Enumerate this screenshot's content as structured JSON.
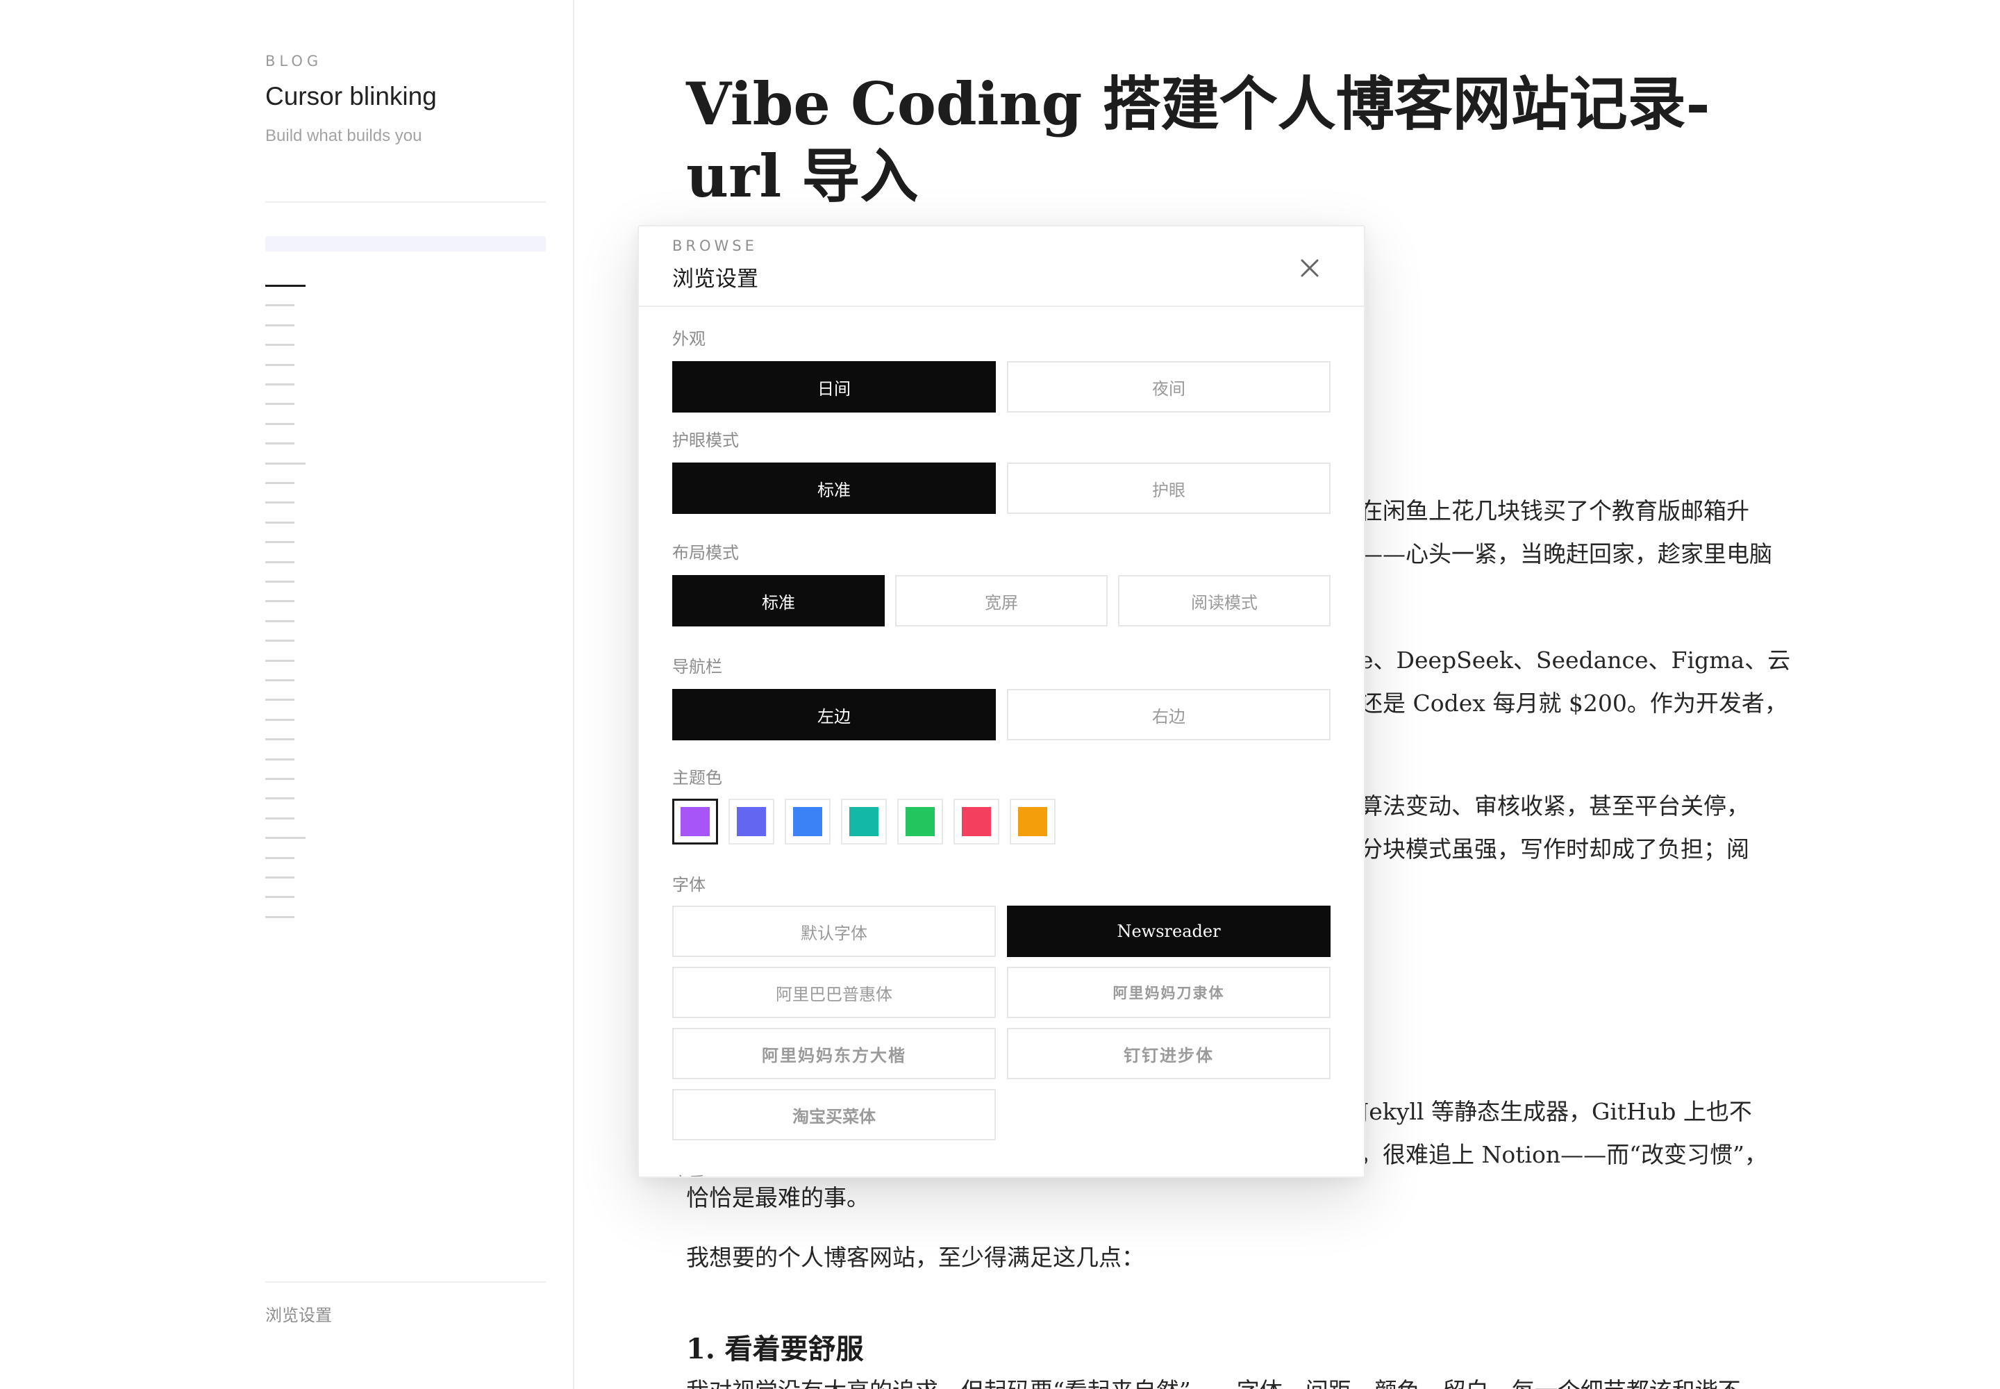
{
  "sidebar": {
    "kicker": "BLOG",
    "title": "Cursor blinking",
    "subtitle": "Build what builds you",
    "settings_link": "浏览设置"
  },
  "article": {
    "title": "Vibe Coding 搭建个人博客网站记录-url 导入",
    "paragraphs": [
      "在闲鱼上花几块钱买了个教育版邮箱升",
      "——心头一紧，当晚赶回家，趁家里电脑",
      "e、DeepSeek、Seedance、Figma、云",
      "还是 Codex 每月就 $200。作为开发者，",
      "算法变动、审核收紧，甚至平台关停，",
      "分块模式虽强，写作时却成了负担；阅",
      "Jekyll 等静态生成器，GitHub 上也不",
      "，很难追上 Notion——而“改变习惯”，",
      "恰恰是最难的事。",
      "我想要的个人博客网站，至少得满足这几点：",
      "我对视觉没有太高的追求，但起码要“看起来自然”——字体、间距、颜色、留白，每一个细节都该和谐不"
    ],
    "heading": "1. 看着要舒服"
  },
  "modal": {
    "kicker": "BROWSE",
    "title": "浏览设置",
    "sections": {
      "appearance": {
        "label": "外观",
        "options": [
          "日间",
          "夜间"
        ]
      },
      "eye_care": {
        "label": "护眼模式",
        "options": [
          "标准",
          "护眼"
        ]
      },
      "layout": {
        "label": "布局模式",
        "options": [
          "标准",
          "宽屏",
          "阅读模式"
        ]
      },
      "navbar": {
        "label": "导航栏",
        "options": [
          "左边",
          "右边"
        ]
      },
      "theme": {
        "label": "主题色",
        "colors": [
          "#a855f7",
          "#6366f1",
          "#3b82f6",
          "#14b8a6",
          "#22c55e",
          "#f43f5e",
          "#f59e0b"
        ],
        "selected": 0
      },
      "font": {
        "label": "字体",
        "options": [
          "默认字体",
          "Newsreader",
          "阿里巴巴普惠体",
          "阿里妈妈刀隶体",
          "阿里妈妈东方大楷",
          "钉钉进步体",
          "淘宝买菜体"
        ],
        "selected": "Newsreader"
      },
      "next_label_peek": "字重"
    }
  }
}
